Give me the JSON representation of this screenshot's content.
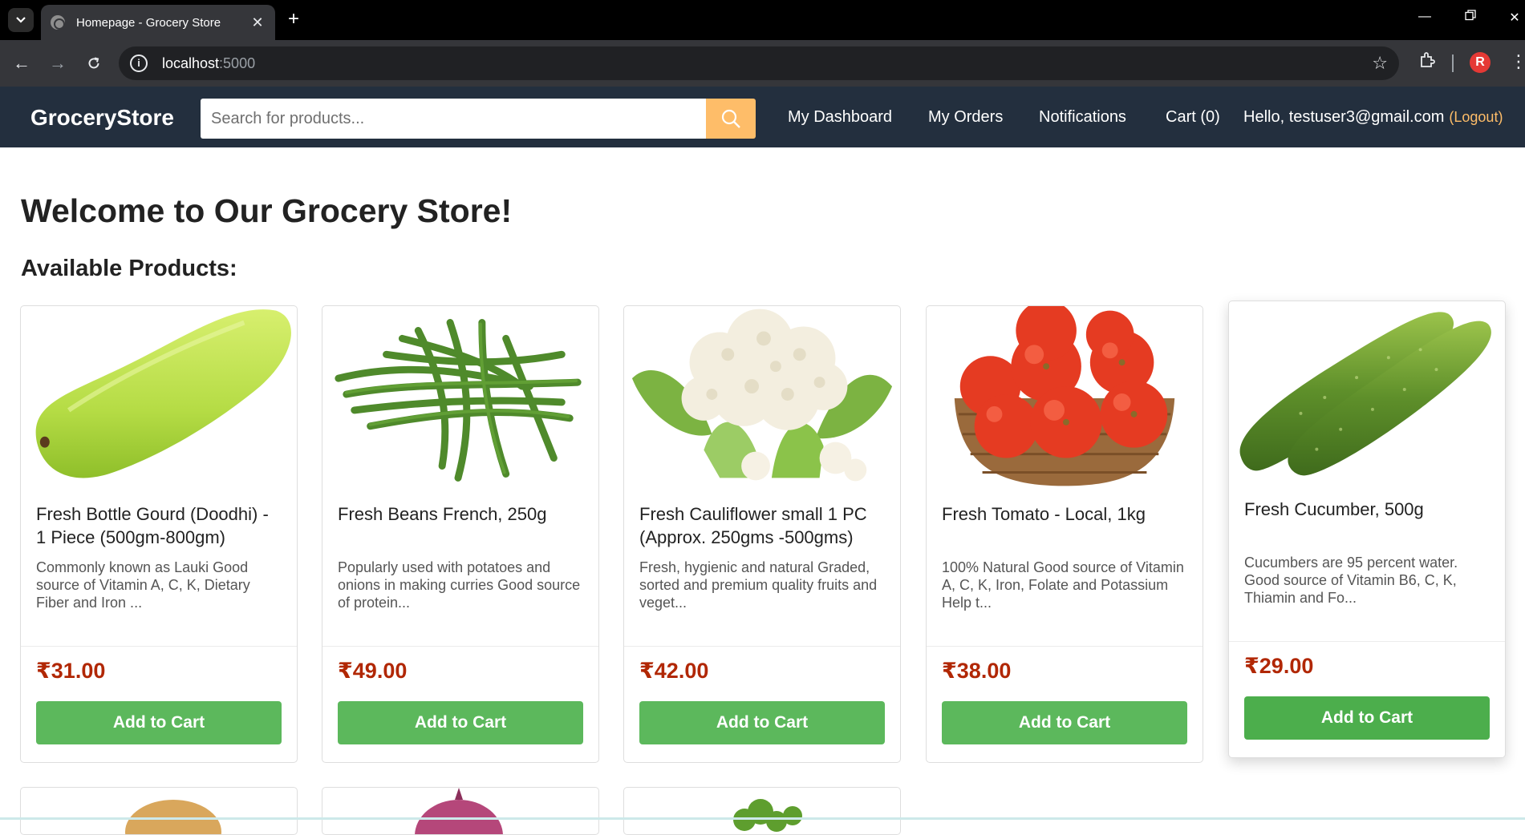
{
  "browser": {
    "tab_title": "Homepage - Grocery Store",
    "url_host": "localhost",
    "url_port": ":5000",
    "profile_initial": "R"
  },
  "navbar": {
    "brand": "GroceryStore",
    "search_placeholder": "Search for products...",
    "links": {
      "dashboard": "My Dashboard",
      "orders": "My Orders",
      "notifications": "Notifications",
      "cart": "Cart (0)"
    },
    "greeting": "Hello, testuser3@gmail.com",
    "logout": "(Logout)"
  },
  "main": {
    "welcome": "Welcome to Our Grocery Store!",
    "subheading": "Available Products:",
    "products": [
      {
        "name": "Fresh Bottle Gourd (Doodhi) - 1 Piece (500gm-800gm)",
        "description": "Commonly known as Lauki Good source of Vitamin A, C, K, Dietary Fiber and Iron ...",
        "price": "₹31.00",
        "button": "Add to Cart",
        "image_icon": "bottle-gourd-image"
      },
      {
        "name": "Fresh Beans French, 250g",
        "description": "Popularly used with potatoes and onions in making curries Good source of protein...",
        "price": "₹49.00",
        "button": "Add to Cart",
        "image_icon": "beans-image"
      },
      {
        "name": "Fresh Cauliflower small 1 PC (Approx. 250gms -500gms)",
        "description": "Fresh, hygienic and natural Graded, sorted and premium quality fruits and veget...",
        "price": "₹42.00",
        "button": "Add to Cart",
        "image_icon": "cauliflower-image"
      },
      {
        "name": "Fresh Tomato - Local, 1kg",
        "description": "100% Natural Good source of Vitamin A, C, K, Iron, Folate and Potassium Help t...",
        "price": "₹38.00",
        "button": "Add to Cart",
        "image_icon": "tomato-image"
      },
      {
        "name": "Fresh Cucumber, 500g",
        "description": "Cucumbers are 95 percent water. Good source of Vitamin B6, C, K, Thiamin and Fo...",
        "price": "₹29.00",
        "button": "Add to Cart",
        "image_icon": "cucumber-image"
      }
    ]
  },
  "colors": {
    "navbar_bg": "#232f3e",
    "search_button": "#febd69",
    "price": "#b12704",
    "add_button": "#5cb85c"
  }
}
